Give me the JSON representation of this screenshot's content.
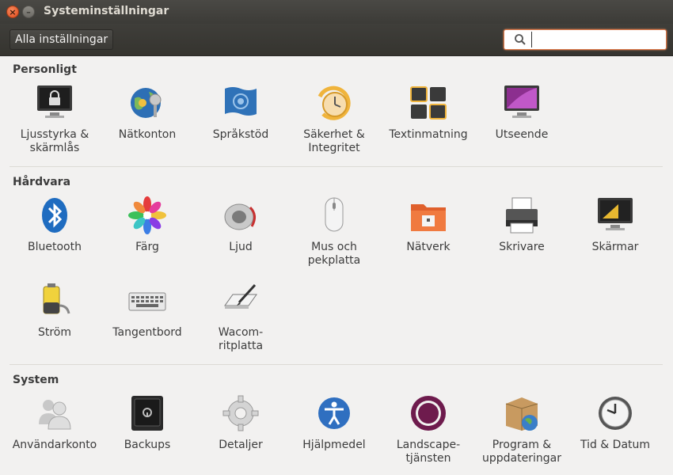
{
  "window": {
    "title": "Systeminställningar"
  },
  "toolbar": {
    "all_settings_label": "Alla inställningar"
  },
  "search": {
    "value": "",
    "placeholder": ""
  },
  "sections": {
    "personal": {
      "title": "Personligt",
      "items": [
        {
          "label": "Ljusstyrka &\nskärmlås",
          "icon": "lock-screen-icon"
        },
        {
          "label": "Nätkonton",
          "icon": "online-accounts-icon"
        },
        {
          "label": "Språkstöd",
          "icon": "language-flag-icon"
        },
        {
          "label": "Säkerhet &\nIntegritet",
          "icon": "security-clock-icon"
        },
        {
          "label": "Textinmatning",
          "icon": "text-entry-icon"
        },
        {
          "label": "Utseende",
          "icon": "appearance-monitor-icon"
        }
      ]
    },
    "hardware": {
      "title": "Hårdvara",
      "items": [
        {
          "label": "Bluetooth",
          "icon": "bluetooth-icon"
        },
        {
          "label": "Färg",
          "icon": "color-flower-icon"
        },
        {
          "label": "Ljud",
          "icon": "speaker-icon"
        },
        {
          "label": "Mus och\npekplatta",
          "icon": "mouse-icon"
        },
        {
          "label": "Nätverk",
          "icon": "network-folder-icon"
        },
        {
          "label": "Skrivare",
          "icon": "printer-icon"
        },
        {
          "label": "Skärmar",
          "icon": "display-icon"
        },
        {
          "label": "Ström",
          "icon": "battery-icon"
        },
        {
          "label": "Tangentbord",
          "icon": "keyboard-icon"
        },
        {
          "label": "Wacom-\nritplatta",
          "icon": "wacom-tablet-icon"
        }
      ]
    },
    "system": {
      "title": "System",
      "items": [
        {
          "label": "Användarkonto",
          "icon": "users-icon"
        },
        {
          "label": "Backups",
          "icon": "safe-icon"
        },
        {
          "label": "Detaljer",
          "icon": "gear-icon"
        },
        {
          "label": "Hjälpmedel",
          "icon": "accessibility-icon"
        },
        {
          "label": "Landscape-\ntjänsten",
          "icon": "landscape-icon"
        },
        {
          "label": "Program &\nuppdateringar",
          "icon": "software-box-icon"
        },
        {
          "label": "Tid & Datum",
          "icon": "clock-icon"
        }
      ]
    }
  }
}
